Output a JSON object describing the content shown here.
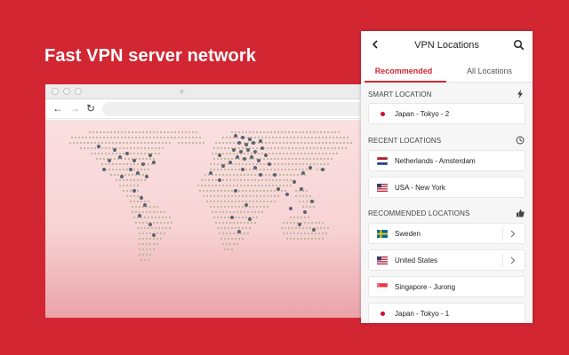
{
  "headline": "Fast VPN server network",
  "browser": {
    "nav": {
      "back": "←",
      "forward": "→",
      "reload": "↻"
    },
    "new_tab": "+"
  },
  "panel": {
    "title": "VPN Locations",
    "tabs": {
      "recommended": "Recommended",
      "all": "All Locations"
    },
    "smart": {
      "label": "SMART LOCATION",
      "item": "Japan - Tokyo - 2"
    },
    "recent": {
      "label": "RECENT LOCATIONS",
      "items": [
        {
          "name": "Netherlands - Amsterdam",
          "flag": "netherlands-flag"
        },
        {
          "name": "USA - New York",
          "flag": "usa-flag"
        }
      ]
    },
    "recommended": {
      "label": "RECOMMENDED LOCATIONS",
      "items": [
        {
          "name": "Sweden",
          "flag": "sweden-flag"
        },
        {
          "name": "United States",
          "flag": "usa-flag"
        },
        {
          "name": "Singapore - Jurong",
          "flag": "singapore-flag"
        },
        {
          "name": "Japan - Tokyo - 1",
          "flag": "japan-dot"
        }
      ]
    }
  },
  "colors": {
    "brand": "#d22733",
    "land": "#b8b898",
    "server": "#5a6470"
  }
}
